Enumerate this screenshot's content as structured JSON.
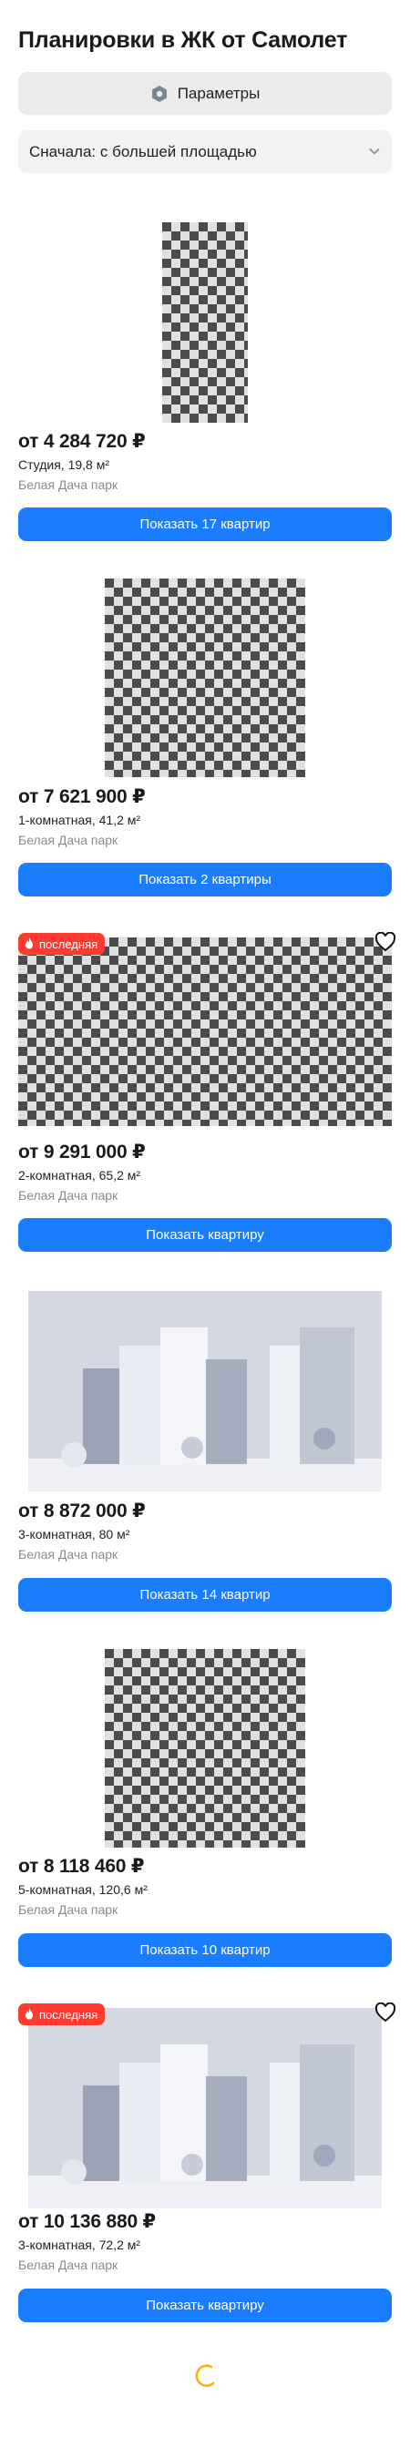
{
  "page": {
    "title": "Планировки в ЖК от Самолет"
  },
  "controls": {
    "params_label": "Параметры",
    "sort_value": "Сначала: с большей площадью"
  },
  "badge_label": "последняя",
  "colors": {
    "accent": "#1a7cff",
    "badge": "#ff3b30"
  },
  "icons": {
    "params": "settings-hexagon-icon",
    "sort": "chevron-down-icon",
    "fire": "fire-icon",
    "favorite": "heart-icon",
    "loading": "spinner-icon"
  },
  "cards": [
    {
      "price": "от 4 284 720 ₽",
      "desc": "Студия, 19,8 м²",
      "complex": "Белая Дача парк",
      "button": "Показать 17 квартир"
    },
    {
      "price": "от 7 621 900 ₽",
      "desc": "1-комнатная, 41,2 м²",
      "complex": "Белая Дача парк",
      "button": "Показать 2 квартиры"
    },
    {
      "price": "от 9 291 000 ₽",
      "desc": "2-комнатная, 65,2 м²",
      "complex": "Белая Дача парк",
      "button": "Показать квартиру"
    },
    {
      "price": "от 8 872 000 ₽",
      "desc": "3-комнатная, 80 м²",
      "complex": "Белая Дача парк",
      "button": "Показать 14 квартир"
    },
    {
      "price": "от 8 118 460 ₽",
      "desc": "5-комнатная, 120,6 м²",
      "complex": "Белая Дача парк",
      "button": "Показать 10 квартир"
    },
    {
      "price": "от 10 136 880 ₽",
      "desc": "3-комнатная, 72,2 м²",
      "complex": "Белая Дача парк",
      "button": "Показать квартиру"
    }
  ]
}
